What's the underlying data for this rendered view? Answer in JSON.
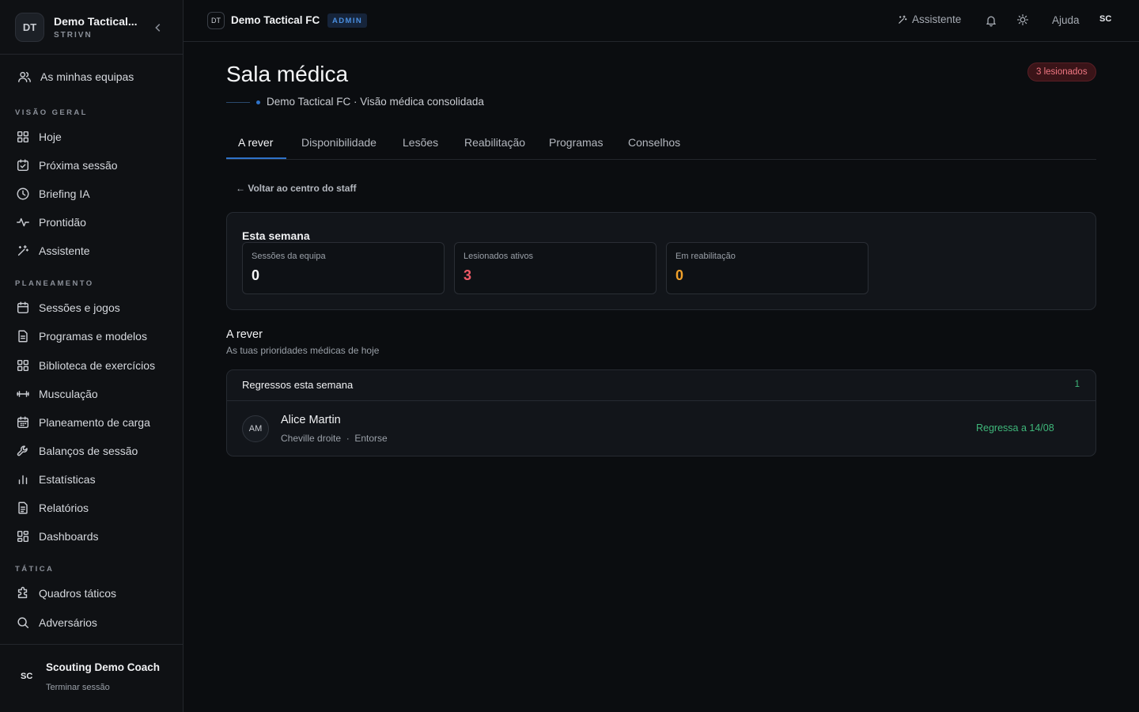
{
  "sidebar": {
    "team_initials": "DT",
    "team_name": "Demo Tactical...",
    "team_sub": "STRIVN",
    "my_teams": "As minhas equipas",
    "sections": {
      "overview": "VISÃO GERAL",
      "planning": "PLANEAMENTO",
      "tactics": "TÁTICA"
    },
    "items": {
      "today": "Hoje",
      "next_session": "Próxima sessão",
      "briefing": "Briefing IA",
      "readiness": "Prontidão",
      "assistant": "Assistente",
      "sessions_games": "Sessões e jogos",
      "programs_templates": "Programas e modelos",
      "exercise_library": "Biblioteca de exercícios",
      "strength": "Musculação",
      "load_planning": "Planeamento de carga",
      "session_reviews": "Balanços de sessão",
      "statistics": "Estatísticas",
      "reports": "Relatórios",
      "dashboards": "Dashboards",
      "tactical_boards": "Quadros táticos",
      "opponents": "Adversários"
    },
    "user": {
      "initials": "SC",
      "name": "Scouting Demo Coach",
      "logout": "Terminar sessão"
    }
  },
  "topbar": {
    "team_initials": "DT",
    "team_name": "Demo Tactical FC",
    "role_badge": "ADMIN",
    "assistant": "Assistente",
    "help": "Ajuda",
    "user_initials": "SC"
  },
  "page": {
    "title": "Sala médica",
    "injured_pill": "3 lesionados",
    "subtitle": "Demo Tactical FC · Visão médica consolidada",
    "tabs": [
      "A rever",
      "Disponibilidade",
      "Lesões",
      "Reabilitação",
      "Programas",
      "Conselhos"
    ],
    "back_link": "← Voltar ao centro do staff"
  },
  "week": {
    "title": "Esta semana",
    "kpis": [
      {
        "label": "Sessões da equipa",
        "value": "0",
        "color": "#f4f5f7"
      },
      {
        "label": "Lesionados ativos",
        "value": "3",
        "color": "#ef5a67"
      },
      {
        "label": "Em reabilitação",
        "value": "0",
        "color": "#f0a02a"
      }
    ]
  },
  "review": {
    "title": "A rever",
    "subtitle": "As tuas prioridades médicas de hoje",
    "list_title": "Regressos esta semana",
    "list_count": "1",
    "rows": [
      {
        "initials": "AM",
        "name": "Alice Martin",
        "meta": "Cheville droite  ·  Entorse",
        "return": "Regressa a 14/08"
      }
    ]
  },
  "colors": {
    "accent": "#2f73c9",
    "danger": "#ef5a67",
    "warning": "#f0a02a",
    "success": "#3fb77a"
  }
}
